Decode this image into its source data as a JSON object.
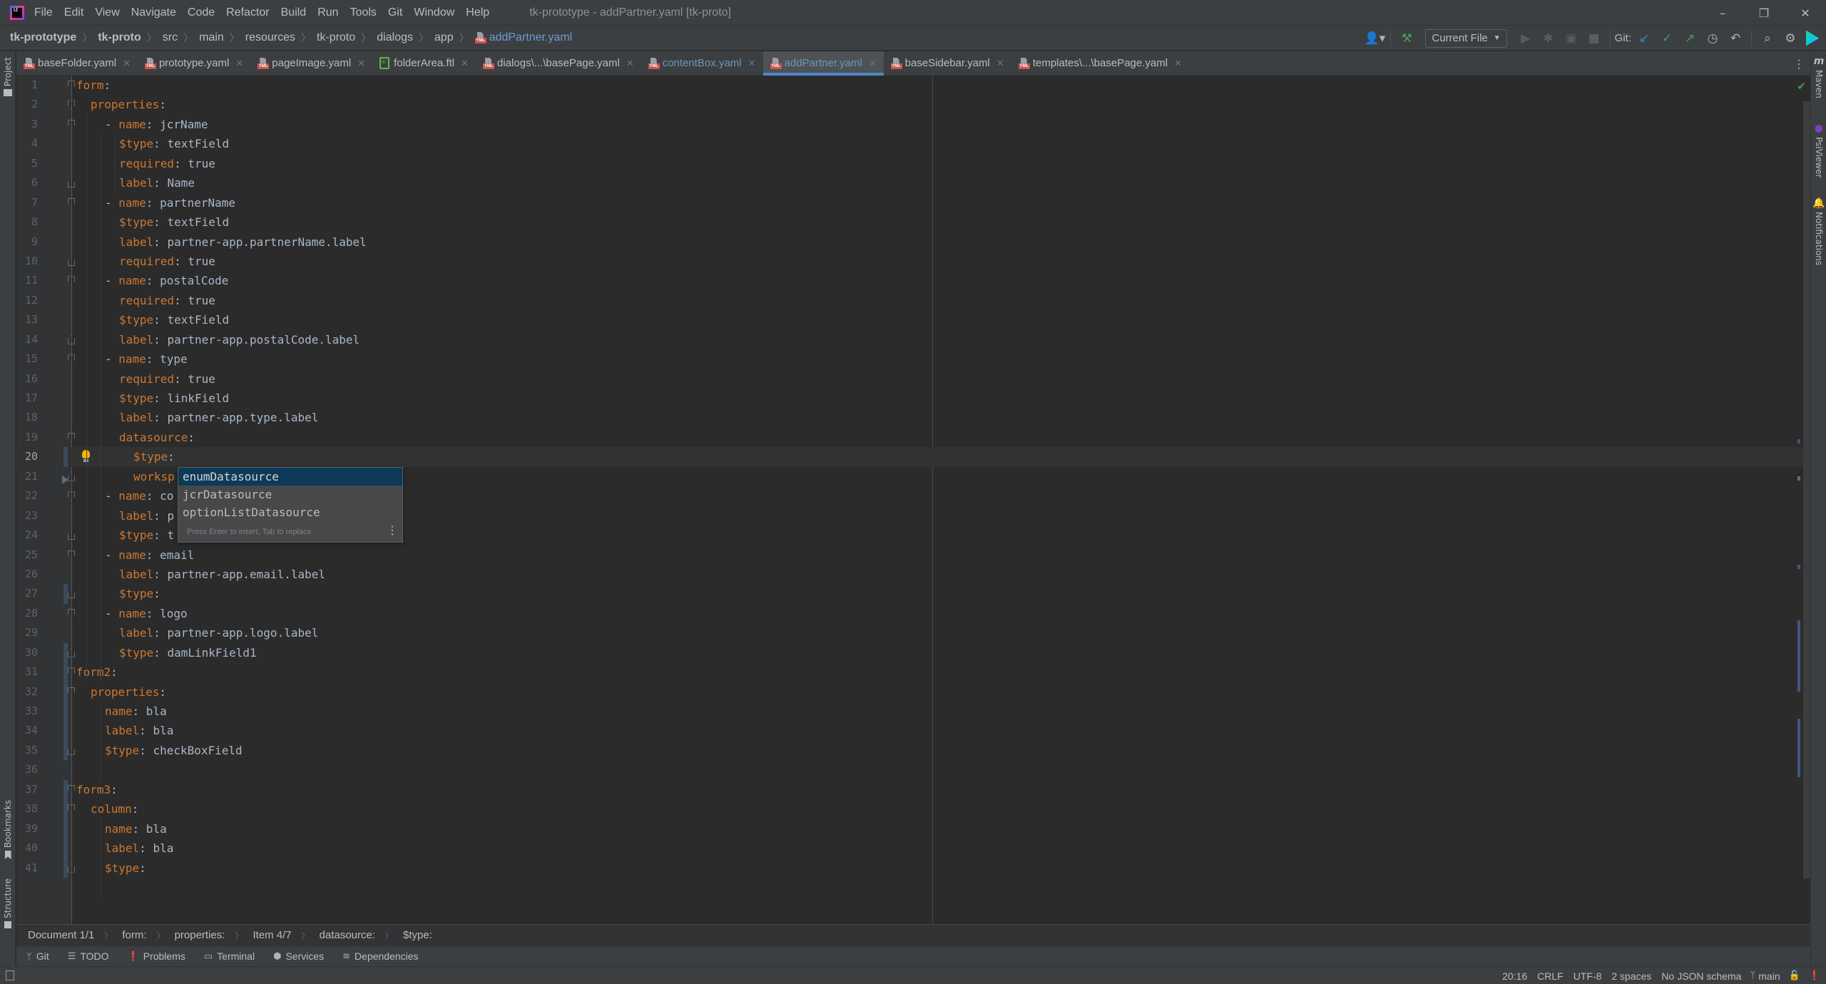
{
  "menubar": {
    "items": [
      "File",
      "Edit",
      "View",
      "Navigate",
      "Code",
      "Refactor",
      "Build",
      "Run",
      "Tools",
      "Git",
      "Window",
      "Help"
    ],
    "window_title": "tk-prototype - addPartner.yaml [tk-proto]",
    "controls": {
      "minimize": "–",
      "restore": "❐",
      "close": "✕"
    }
  },
  "navbar": {
    "breadcrumbs": [
      "tk-prototype",
      "tk-proto",
      "src",
      "main",
      "resources",
      "tk-proto",
      "dialogs",
      "app",
      "addPartner.yaml"
    ],
    "run_config": "Current File",
    "git_label": "Git:"
  },
  "tabs": [
    {
      "label": "baseFolder.yaml",
      "icon": "yaml-file-icon"
    },
    {
      "label": "prototype.yaml",
      "icon": "yaml-file-icon"
    },
    {
      "label": "pageImage.yaml",
      "icon": "yaml-file-icon"
    },
    {
      "label": "folderArea.ftl",
      "icon": "ftl-file-icon"
    },
    {
      "label": "dialogs\\...\\basePage.yaml",
      "icon": "yaml-file-icon"
    },
    {
      "label": "contentBox.yaml",
      "icon": "yaml-file-icon",
      "modified": true
    },
    {
      "label": "addPartner.yaml",
      "icon": "yaml-file-icon",
      "active": true
    },
    {
      "label": "baseSidebar.yaml",
      "icon": "yaml-file-icon"
    },
    {
      "label": "templates\\...\\basePage.yaml",
      "icon": "yaml-file-icon"
    }
  ],
  "left_stripe": {
    "project": "Project",
    "bookmarks": "Bookmarks",
    "structure": "Structure"
  },
  "right_stripe": {
    "maven": "Maven",
    "psiviewer": "PsiViewer",
    "notifications": "Notifications"
  },
  "editor": {
    "current_line": 20,
    "lines": [
      {
        "n": "1",
        "key": "form",
        "val": "",
        "indent": 0
      },
      {
        "n": "2",
        "key": "properties",
        "val": "",
        "indent": 1
      },
      {
        "n": "3",
        "key": "name",
        "val": "jcrName",
        "indent": 2,
        "dash": true
      },
      {
        "n": "4",
        "key": "$type",
        "val": "textField",
        "indent": 3
      },
      {
        "n": "5",
        "key": "required",
        "val": "true",
        "indent": 3
      },
      {
        "n": "6",
        "key": "label",
        "val": "Name",
        "indent": 3
      },
      {
        "n": "7",
        "key": "name",
        "val": "partnerName",
        "indent": 2,
        "dash": true
      },
      {
        "n": "8",
        "key": "$type",
        "val": "textField",
        "indent": 3
      },
      {
        "n": "9",
        "key": "label",
        "val": "partner-app.partnerName.label",
        "indent": 3
      },
      {
        "n": "10",
        "key": "required",
        "val": "true",
        "indent": 3
      },
      {
        "n": "11",
        "key": "name",
        "val": "postalCode",
        "indent": 2,
        "dash": true
      },
      {
        "n": "12",
        "key": "required",
        "val": "true",
        "indent": 3
      },
      {
        "n": "13",
        "key": "$type",
        "val": "textField",
        "indent": 3
      },
      {
        "n": "14",
        "key": "label",
        "val": "partner-app.postalCode.label",
        "indent": 3
      },
      {
        "n": "15",
        "key": "name",
        "val": "type",
        "indent": 2,
        "dash": true
      },
      {
        "n": "16",
        "key": "required",
        "val": "true",
        "indent": 3
      },
      {
        "n": "17",
        "key": "$type",
        "val": "linkField",
        "indent": 3
      },
      {
        "n": "18",
        "key": "label",
        "val": "partner-app.type.label",
        "indent": 3
      },
      {
        "n": "19",
        "key": "datasource",
        "val": "",
        "indent": 3
      },
      {
        "n": "20",
        "key": "$type",
        "val": "",
        "indent": 4
      },
      {
        "n": "21",
        "key": "worksp",
        "val": "",
        "indent": 4,
        "nocolon": true
      },
      {
        "n": "22",
        "key": "name",
        "val": "co",
        "indent": 2,
        "dash": true
      },
      {
        "n": "23",
        "key": "label",
        "val": "p",
        "indent": 3
      },
      {
        "n": "24",
        "key": "$type",
        "val": "t",
        "indent": 3
      },
      {
        "n": "25",
        "key": "name",
        "val": "email",
        "indent": 2,
        "dash": true
      },
      {
        "n": "26",
        "key": "label",
        "val": "partner-app.email.label",
        "indent": 3
      },
      {
        "n": "27",
        "key": "$type",
        "val": "",
        "indent": 3
      },
      {
        "n": "28",
        "key": "name",
        "val": "logo",
        "indent": 2,
        "dash": true
      },
      {
        "n": "29",
        "key": "label",
        "val": "partner-app.logo.label",
        "indent": 3
      },
      {
        "n": "30",
        "key": "$type",
        "val": "damLinkField1",
        "indent": 3
      },
      {
        "n": "31",
        "key": "form2",
        "val": "",
        "indent": 0
      },
      {
        "n": "32",
        "key": "properties",
        "val": "",
        "indent": 1
      },
      {
        "n": "33",
        "key": "name",
        "val": "bla",
        "indent": 2
      },
      {
        "n": "34",
        "key": "label",
        "val": "bla",
        "indent": 2
      },
      {
        "n": "35",
        "key": "$type",
        "val": "checkBoxField",
        "indent": 2
      },
      {
        "n": "36",
        "key": "",
        "val": "",
        "indent": 0,
        "blank": true
      },
      {
        "n": "37",
        "key": "form3",
        "val": "",
        "indent": 0
      },
      {
        "n": "38",
        "key": "column",
        "val": "",
        "indent": 1
      },
      {
        "n": "39",
        "key": "name",
        "val": "bla",
        "indent": 2
      },
      {
        "n": "40",
        "key": "label",
        "val": "bla",
        "indent": 2
      },
      {
        "n": "41",
        "key": "$type",
        "val": "",
        "indent": 2
      }
    ]
  },
  "completion": {
    "items": [
      "enumDatasource",
      "jcrDatasource",
      "optionListDatasource"
    ],
    "selected_index": 0,
    "footer": "Press Enter to insert, Tab to replace"
  },
  "editor_breadcrumbs": [
    "Document 1/1",
    "form:",
    "properties:",
    "Item 4/7",
    "datasource:",
    "$type:"
  ],
  "toolwindows": [
    {
      "label": "Git",
      "icon": "git-branch-icon"
    },
    {
      "label": "TODO",
      "icon": "list-icon"
    },
    {
      "label": "Problems",
      "icon": "problems-icon"
    },
    {
      "label": "Terminal",
      "icon": "terminal-icon"
    },
    {
      "label": "Services",
      "icon": "services-icon"
    },
    {
      "label": "Dependencies",
      "icon": "dependencies-icon"
    }
  ],
  "statusbar": {
    "position": "20:16",
    "line_separator": "CRLF",
    "encoding": "UTF-8",
    "indent": "2 spaces",
    "schema": "No JSON schema",
    "branch": "main"
  }
}
